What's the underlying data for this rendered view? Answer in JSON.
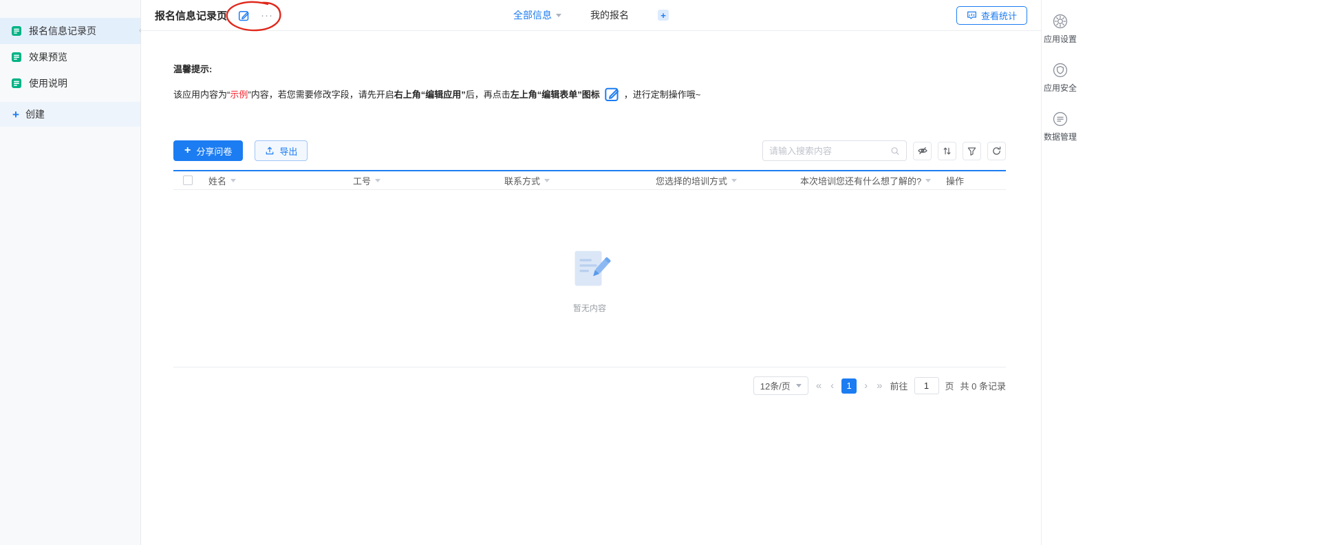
{
  "colors": {
    "primary": "#1c7cf2",
    "green": "#00b386",
    "annotation_red": "#e0281b"
  },
  "icons": {
    "plus": "+",
    "more": "···",
    "collapse": "‹",
    "pagination_first": "«",
    "pagination_prev": "‹",
    "pagination_next": "›",
    "pagination_last": "»"
  },
  "sidebar": {
    "items": [
      {
        "label": "报名信息记录页"
      },
      {
        "label": "效果预览"
      },
      {
        "label": "使用说明"
      }
    ],
    "create_label": "创建"
  },
  "header": {
    "title": "报名信息记录页",
    "tabs": [
      {
        "label": "全部信息"
      },
      {
        "label": "我的报名"
      }
    ],
    "stats_button": "查看统计"
  },
  "notice": {
    "title": "温馨提示:",
    "seg1": "该应用内容为“",
    "seg2": "示例",
    "seg3": "”内容，若您需要修改字段，请先开启",
    "seg4": "右上角“编辑应用”",
    "seg5": "后，再点击",
    "seg6": "左上角“编辑表单”图标",
    "seg7": "，进行定制操作哦~"
  },
  "toolbar": {
    "share_button": "分享问卷",
    "export_button": "导出",
    "search_placeholder": "请输入搜索内容"
  },
  "table": {
    "columns": [
      "姓名",
      "工号",
      "联系方式",
      "您选择的培训方式",
      "本次培训您还有什么想了解的?",
      "操作"
    ],
    "empty_text": "暂无内容"
  },
  "pagination": {
    "page_size": "12条/页",
    "current_page": "1",
    "goto_label": "前往",
    "goto_value": "1",
    "unit_label": "页",
    "total_label": "共 0 条记录"
  },
  "right_rail": {
    "items": [
      {
        "label": "应用设置"
      },
      {
        "label": "应用安全"
      },
      {
        "label": "数据管理"
      }
    ]
  }
}
